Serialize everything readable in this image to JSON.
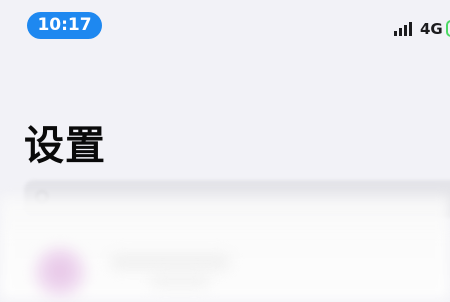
{
  "status_bar": {
    "time": "10:17",
    "network": "4G",
    "signal_icon": "signal-bars-icon",
    "battery_icon": "battery-icon",
    "time_pill_color": "#1e88f0",
    "battery_color": "#4cd964"
  },
  "header": {
    "title": "设置"
  },
  "search": {
    "icon": "search-icon"
  },
  "list": {
    "items": [
      {
        "avatar_icon": "avatar"
      }
    ]
  }
}
